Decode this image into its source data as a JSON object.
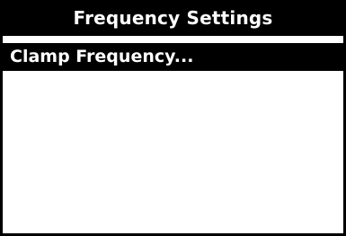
{
  "window": {
    "title": "Frequency Settings"
  },
  "menu": {
    "items": [
      {
        "label": "Clamp Frequency...",
        "selected": true
      }
    ]
  },
  "colors": {
    "background": "#ffffff",
    "foreground": "#000000",
    "highlight": "#000000",
    "highlight_text": "#ffffff"
  }
}
